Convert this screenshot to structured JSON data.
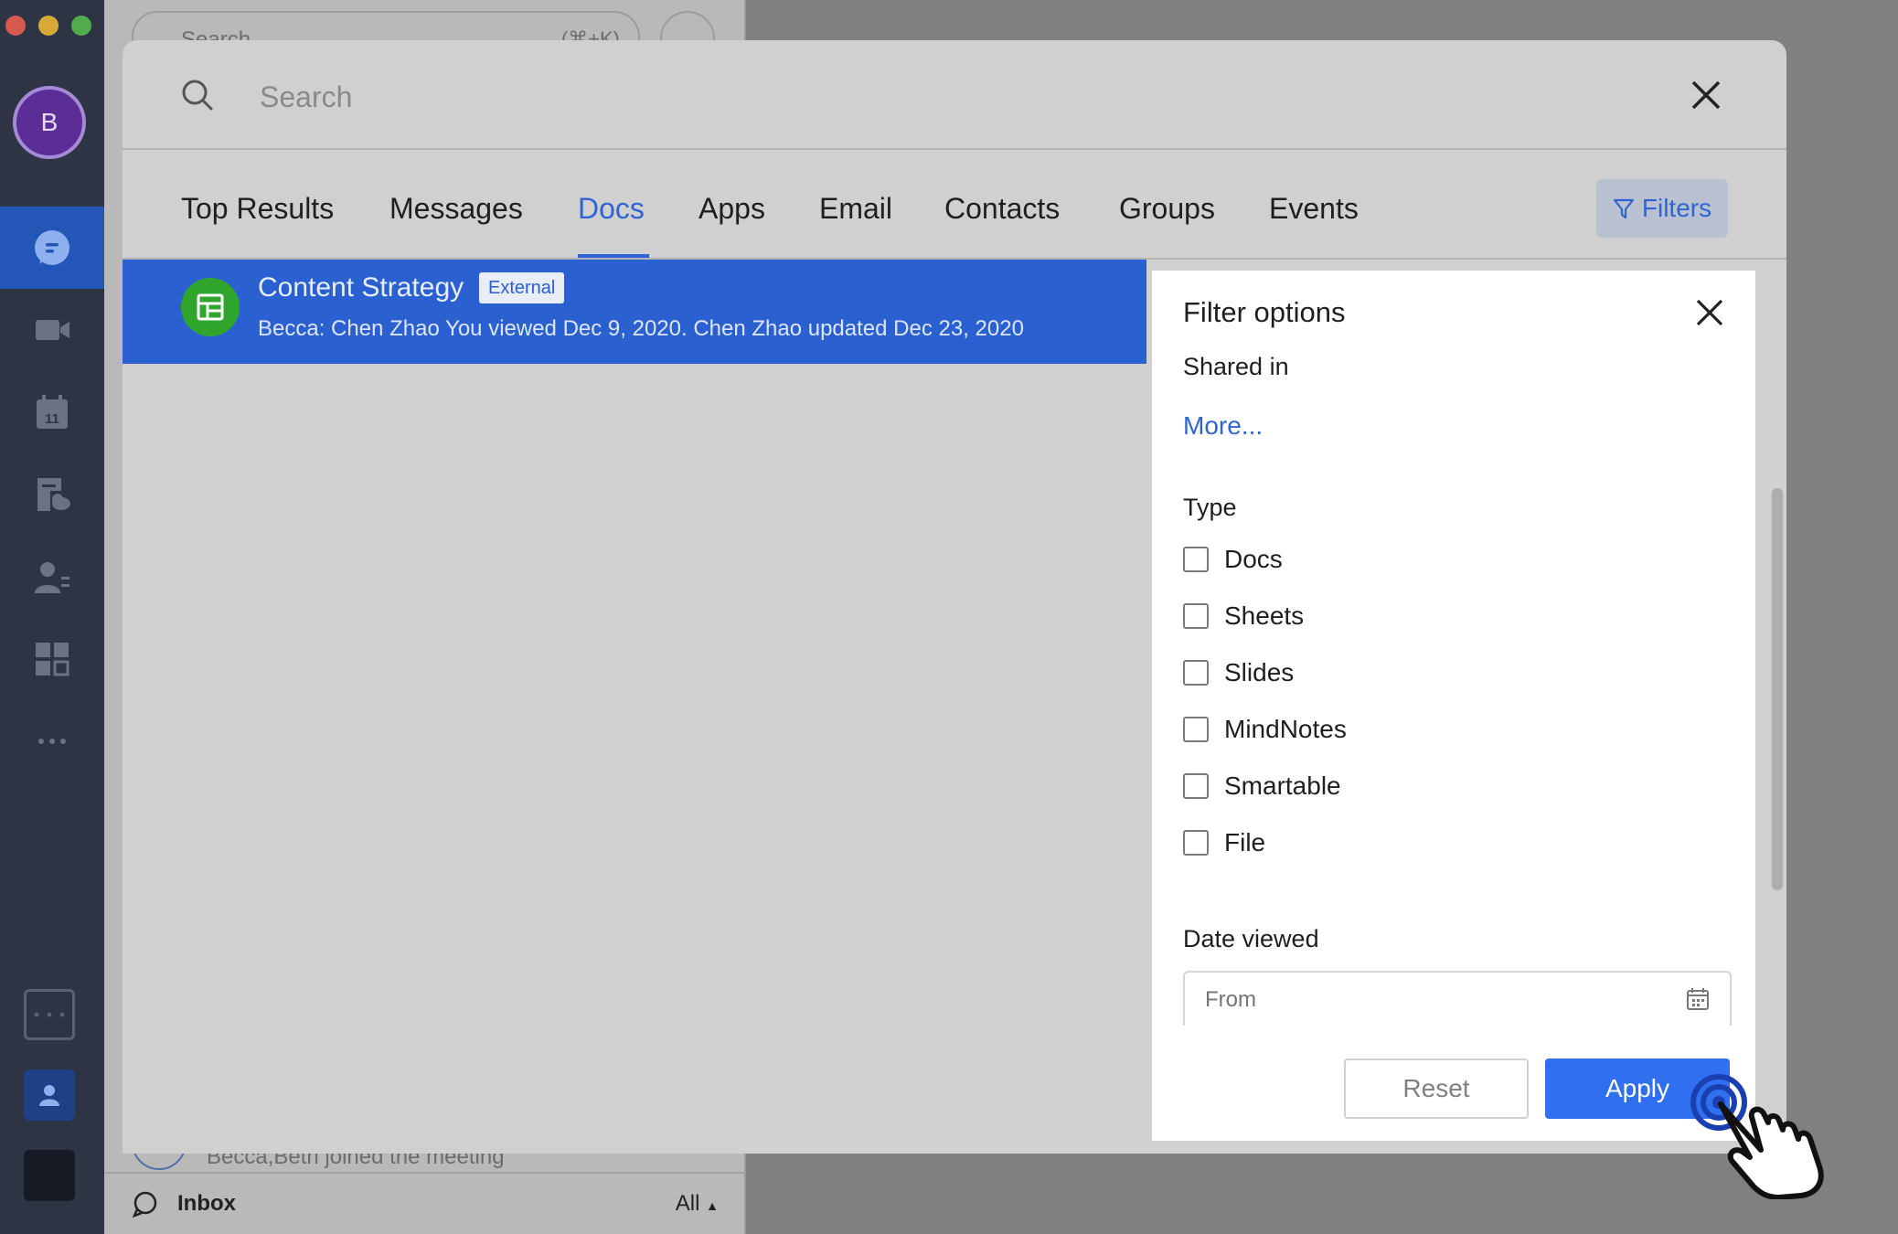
{
  "window": {
    "traffic_light_colors": [
      "#d65a4e",
      "#d9a938",
      "#4fae4b"
    ]
  },
  "rail": {
    "avatar_initial": "B",
    "calendar_day": "11",
    "items": [
      {
        "icon": "chat-icon",
        "active": true
      },
      {
        "icon": "video-icon",
        "active": false
      },
      {
        "icon": "calendar-icon",
        "active": false
      },
      {
        "icon": "docs-cloud-icon",
        "active": false
      },
      {
        "icon": "contacts-icon",
        "active": false
      },
      {
        "icon": "workplace-icon",
        "active": false
      },
      {
        "icon": "more-icon",
        "active": false
      }
    ],
    "accent_color": "#2456b8"
  },
  "background_panel": {
    "search_placeholder": "Search",
    "search_shortcut": "(⌘+K)",
    "notice": "Becca,Beth joined the meeting",
    "inbox_label": "Inbox",
    "inbox_filter": "All"
  },
  "modal": {
    "search_placeholder": "Search",
    "tabs": [
      {
        "label": "Top Results",
        "active": false
      },
      {
        "label": "Messages",
        "active": false
      },
      {
        "label": "Docs",
        "active": true
      },
      {
        "label": "Apps",
        "active": false
      },
      {
        "label": "Email",
        "active": false
      },
      {
        "label": "Contacts",
        "active": false
      },
      {
        "label": "Groups",
        "active": false
      },
      {
        "label": "Events",
        "active": false
      }
    ],
    "filters_label": "Filters",
    "accent_color": "#2f64d2",
    "results": [
      {
        "title": "Content Strategy",
        "badge": "External",
        "meta": "Becca: Chen Zhao You viewed Dec 9, 2020. Chen Zhao updated Dec 23, 2020",
        "icon": "sheet-icon"
      }
    ]
  },
  "filter_panel": {
    "title": "Filter options",
    "shared_in_label": "Shared in",
    "more_link": "More...",
    "type_label": "Type",
    "type_options": [
      {
        "label": "Docs",
        "checked": false
      },
      {
        "label": "Sheets",
        "checked": false
      },
      {
        "label": "Slides",
        "checked": false
      },
      {
        "label": "MindNotes",
        "checked": false
      },
      {
        "label": "Smartable",
        "checked": false
      },
      {
        "label": "File",
        "checked": false
      }
    ],
    "date_viewed_label": "Date viewed",
    "date_from_placeholder": "From",
    "reset_label": "Reset",
    "apply_label": "Apply",
    "apply_color": "#2f6ff0"
  }
}
